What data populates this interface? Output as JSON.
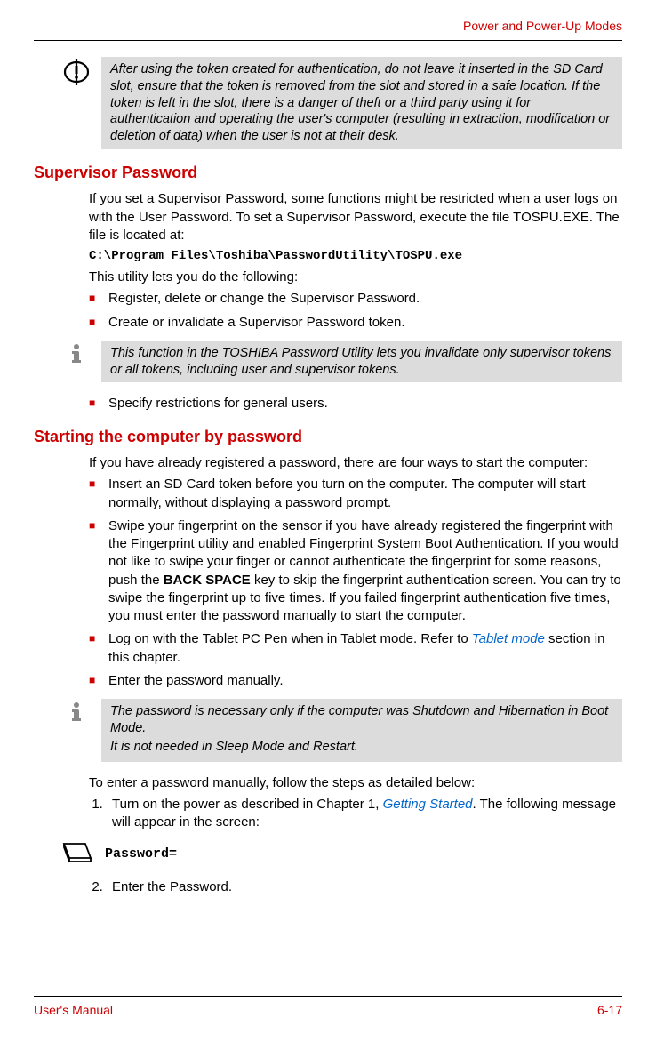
{
  "header": "Power and Power-Up Modes",
  "callout1": "After using the token created for authentication, do not leave it inserted in the SD Card slot, ensure that the token is removed from the slot and stored in a safe location. If the token is left in the slot, there is a danger of theft or a third party using it for authentication and operating the user's computer (resulting in extraction, modification or deletion of data) when the user is not at their desk.",
  "section1": {
    "heading": "Supervisor Password",
    "p1": "If you set a Supervisor Password, some functions might be restricted when a user logs on with the User Password. To set a Supervisor Password, execute the file TOSPU.EXE. The file is located at:",
    "path": "C:\\Program Files\\Toshiba\\PasswordUtility\\TOSPU.exe",
    "p2": "This utility lets you do the following:",
    "bullets1": [
      "Register, delete or change the Supervisor Password.",
      "Create or invalidate a Supervisor Password token."
    ],
    "note": "This function in the TOSHIBA Password Utility lets you invalidate only supervisor tokens or all tokens, including user and supervisor tokens.",
    "bullets2": [
      "Specify restrictions for general users."
    ]
  },
  "section2": {
    "heading": "Starting the computer by password",
    "p1": "If you have already registered a password, there are four ways to start the computer:",
    "bullets": {
      "b1": "Insert an SD Card token before you turn on the computer. The computer will start normally, without displaying a password prompt.",
      "b2_a": "Swipe your fingerprint on the sensor if you have already registered the fingerprint with the Fingerprint utility and enabled Fingerprint System Boot Authentication. If you would not like to swipe your finger or cannot authenticate the fingerprint for some reasons, push the ",
      "b2_bold": "BACK SPACE",
      "b2_b": " key to skip the fingerprint authentication screen. You can try to swipe the fingerprint up to five times. If you failed fingerprint authentication five times, you must enter the password manually to start the computer.",
      "b3_a": "Log on with the Tablet PC Pen when in Tablet mode. Refer to ",
      "b3_link": "Tablet mode",
      "b3_b": " section in this chapter.",
      "b4": "Enter the password manually."
    },
    "note_p1": "The password is necessary only if the computer was Shutdown and Hibernation in Boot Mode.",
    "note_p2": "It is not needed in Sleep Mode and Restart.",
    "p2": "To enter a password manually, follow the steps as detailed below:",
    "step1_a": "Turn on the power as described in Chapter 1, ",
    "step1_link": "Getting Started",
    "step1_b": ". The following message will appear in the screen:",
    "prompt": "Password=",
    "step2": "Enter the Password."
  },
  "footer": {
    "left": "User's Manual",
    "right": "6-17"
  }
}
